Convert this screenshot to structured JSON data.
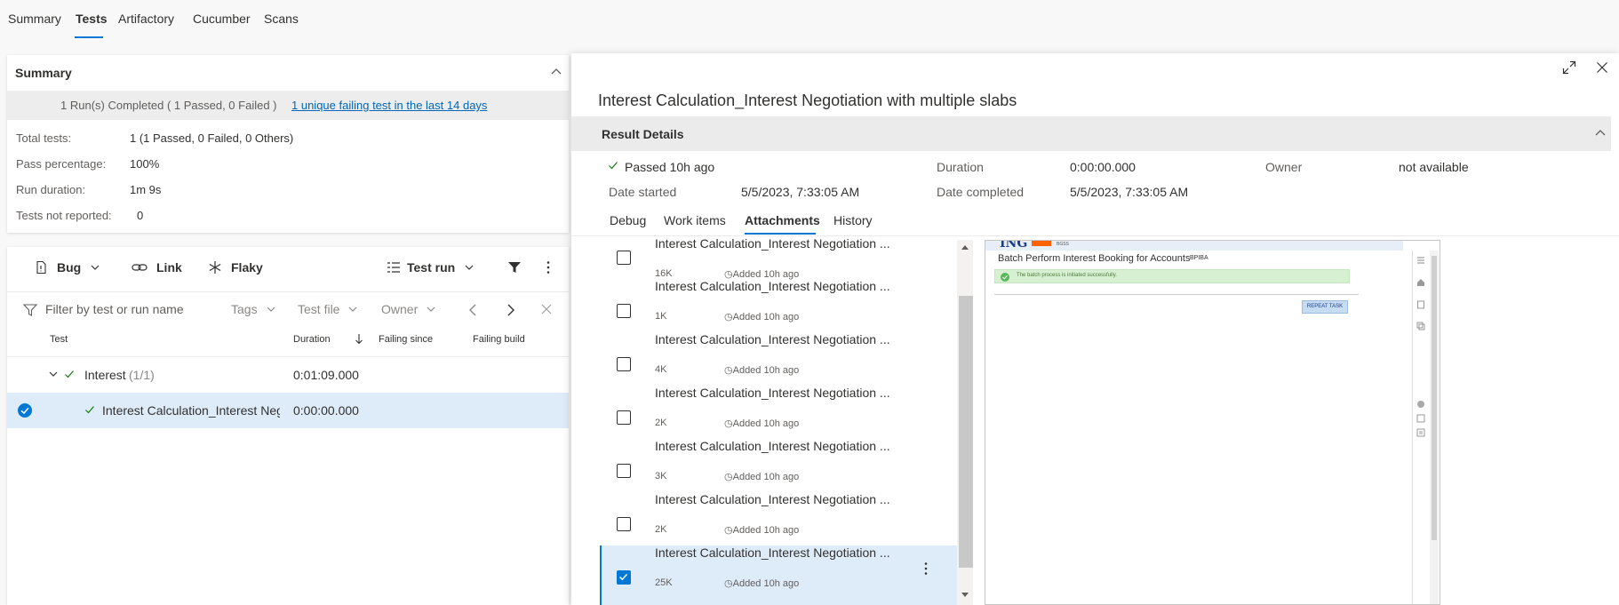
{
  "top_tabs": [
    "Summary",
    "Tests",
    "Artifactory",
    "Cucumber",
    "Scans"
  ],
  "active_tab": "Tests",
  "summary": {
    "title": "Summary",
    "banner": "1 Run(s) Completed ( 1 Passed, 0 Failed )",
    "banner_link": "1 unique failing test in the last 14 days",
    "stats": [
      {
        "label": "Total tests:",
        "value": "1 (1 Passed, 0 Failed, 0 Others)"
      },
      {
        "label": "Pass percentage:",
        "value": "100%"
      },
      {
        "label": "Run duration:",
        "value": "1m 9s"
      },
      {
        "label": "Tests not reported:",
        "value": "0"
      }
    ]
  },
  "toolbar": {
    "bug": "Bug",
    "link": "Link",
    "flaky": "Flaky",
    "test_run": "Test run"
  },
  "filters": {
    "placeholder": "Filter by test or run name",
    "tags": "Tags",
    "test_file": "Test file",
    "owner": "Owner"
  },
  "columns": {
    "test": "Test",
    "duration": "Duration",
    "failing_since": "Failing since",
    "failing_build": "Failing build"
  },
  "tree": {
    "group": {
      "name": "Interest",
      "count": "(1/1)",
      "duration": "0:01:09.000"
    },
    "test": {
      "name": "Interest Calculation_Interest Neg",
      "duration": "0:00:00.000"
    }
  },
  "panel": {
    "title": "Interest Calculation_Interest Negotiation with multiple slabs",
    "result_details": "Result Details",
    "status": "Passed 10h ago",
    "duration_label": "Duration",
    "duration_value": "0:00:00.000",
    "owner_label": "Owner",
    "owner_value": "not available",
    "date_started_label": "Date started",
    "date_started_value": "5/5/2023, 7:33:05 AM",
    "date_completed_label": "Date completed",
    "date_completed_value": "5/5/2023, 7:33:05 AM",
    "tabs": [
      "Debug",
      "Work items",
      "Attachments",
      "History"
    ],
    "active_tab": "Attachments"
  },
  "attachments": [
    {
      "name": "Interest Calculation_Interest Negotiation ...",
      "size": "16K",
      "added": "Added 10h ago"
    },
    {
      "name": "Interest Calculation_Interest Negotiation ...",
      "size": "1K",
      "added": "Added 10h ago"
    },
    {
      "name": "Interest Calculation_Interest Negotiation ...",
      "size": "4K",
      "added": "Added 10h ago"
    },
    {
      "name": "Interest Calculation_Interest Negotiation ...",
      "size": "2K",
      "added": "Added 10h ago"
    },
    {
      "name": "Interest Calculation_Interest Negotiation ...",
      "size": "3K",
      "added": "Added 10h ago"
    },
    {
      "name": "Interest Calculation_Interest Negotiation ...",
      "size": "2K",
      "added": "Added 10h ago"
    },
    {
      "name": "Interest Calculation_Interest Negotiation ...",
      "size": "25K",
      "added": "Added 10h ago"
    }
  ],
  "preview": {
    "logo": "ING",
    "logo_small": "BGSS",
    "title": "Batch Perform Interest Booking for Accounts",
    "code": "BPIBA",
    "success": "The batch process is initiated successfully.",
    "button": "REPEAT TASK"
  },
  "colors": {
    "accent": "#0078d4",
    "link": "#0067b8",
    "selected": "#deecf9",
    "pass": "#107c10"
  }
}
